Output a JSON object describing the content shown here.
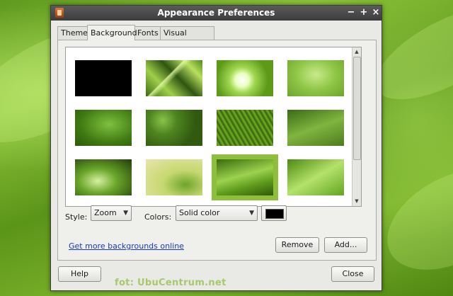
{
  "window": {
    "title": "Appearance Preferences",
    "controls": {
      "minimize": "−",
      "maximize": "+",
      "close": "×"
    }
  },
  "tabs": [
    {
      "label": "Theme",
      "selected": false
    },
    {
      "label": "Background",
      "selected": true
    },
    {
      "label": "Fonts",
      "selected": false
    },
    {
      "label": "Visual Effects",
      "selected": false
    }
  ],
  "backgrounds": [
    {
      "id": "black",
      "selected": false
    },
    {
      "id": "green-triangles",
      "selected": false
    },
    {
      "id": "green-swirl-white",
      "selected": false
    },
    {
      "id": "light-green-logo",
      "selected": false
    },
    {
      "id": "green-logo-dark",
      "selected": false
    },
    {
      "id": "green-bokeh",
      "selected": false
    },
    {
      "id": "green-fibers",
      "selected": false
    },
    {
      "id": "green-leaf-macro",
      "selected": false
    },
    {
      "id": "green-rings",
      "selected": false
    },
    {
      "id": "green-leaves-logo",
      "selected": false
    },
    {
      "id": "green-waves",
      "selected": true
    },
    {
      "id": "green-light-rays",
      "selected": false
    }
  ],
  "options": {
    "style_label": "Style:",
    "style_value": "Zoom",
    "colors_label": "Colors:",
    "colors_value": "Solid color",
    "color_swatch": "#000000"
  },
  "actions": {
    "more_link": "Get more backgrounds online",
    "remove": "Remove",
    "add": "Add..."
  },
  "footer": {
    "help": "Help",
    "close": "Close"
  },
  "watermark": "fot: UbuCentrum.net",
  "colors": {
    "accent_selection": "#8fbf3a",
    "link": "#1a36c8",
    "titlebar": "#4a4a4a"
  }
}
